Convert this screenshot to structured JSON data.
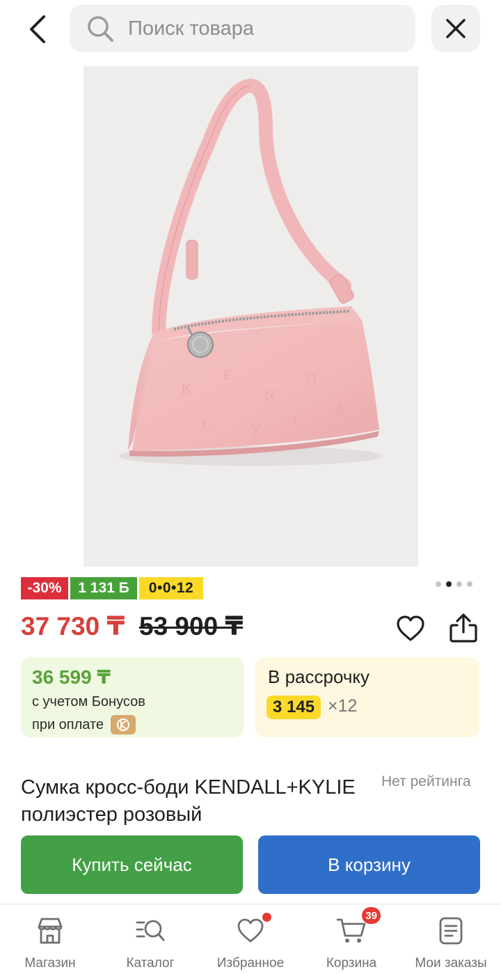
{
  "search": {
    "placeholder": "Поиск товара"
  },
  "badges": {
    "discount": "-30%",
    "bonus": "1 131 Б",
    "installment": "0•0•12"
  },
  "gallery": {
    "total": 4,
    "active_index": 1
  },
  "price": {
    "current": "37 730 ₸",
    "old": "53 900 ₸"
  },
  "bonus_card": {
    "amount": "36 599 ₸",
    "line1": "с учетом Бонусов",
    "line2": "при оплате"
  },
  "installment_card": {
    "title": "В рассрочку",
    "monthly": "3 145",
    "months": "×12"
  },
  "product": {
    "title": "Сумка кросс-боди KENDALL+KYLIE полиэстер розовый",
    "rating": "Нет рейтинга"
  },
  "actions": {
    "buy_now": "Купить сейчас",
    "add_to_cart": "В корзину"
  },
  "nav": {
    "items": [
      {
        "label": "Магазин",
        "icon": "store-icon"
      },
      {
        "label": "Каталог",
        "icon": "catalog-icon"
      },
      {
        "label": "Избранное",
        "icon": "heart-icon",
        "has_dot": true
      },
      {
        "label": "Корзина",
        "icon": "cart-icon",
        "badge": "39"
      },
      {
        "label": "Мои заказы",
        "icon": "orders-icon"
      }
    ]
  },
  "colors": {
    "discount": "#dc2f3c",
    "bonus": "#46a238",
    "installment": "#fbd929",
    "price": "#d6403a",
    "buy_button": "#43a046",
    "cart_button": "#2f6fc9"
  }
}
